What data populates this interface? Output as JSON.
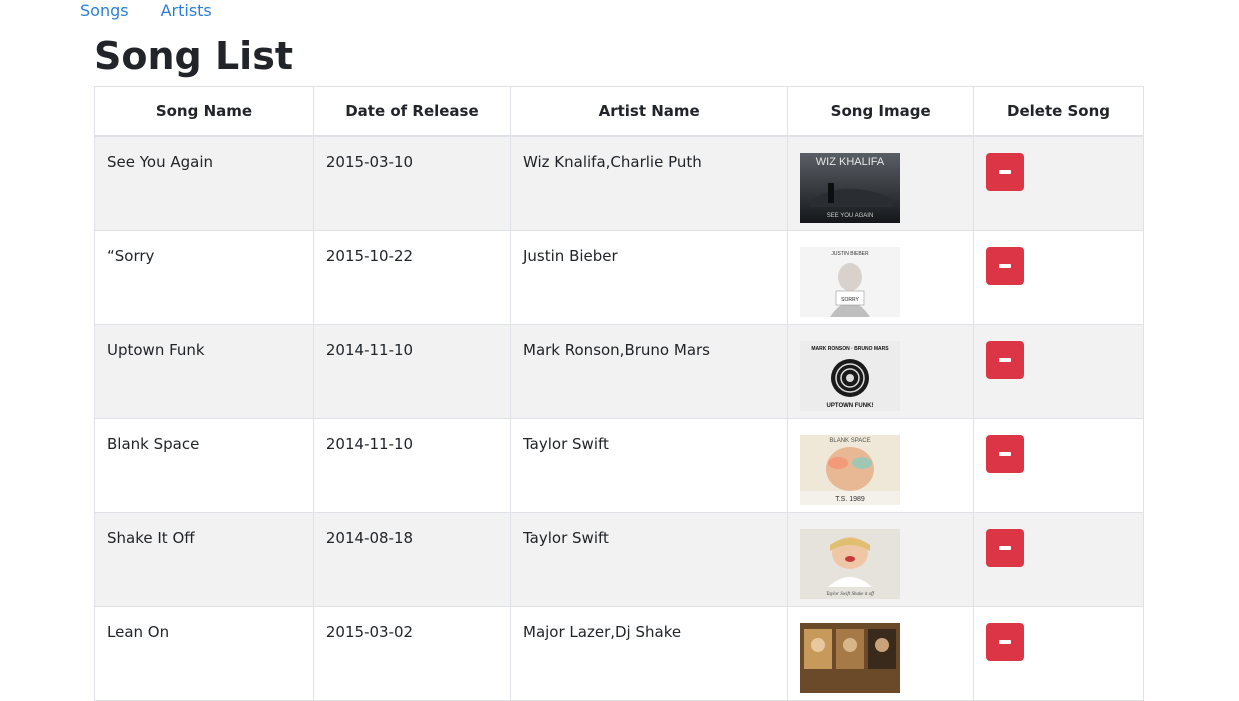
{
  "nav": {
    "songs_label": "Songs",
    "artists_label": "Artists"
  },
  "page": {
    "title": "Song List"
  },
  "table": {
    "headers": [
      "Song Name",
      "Date of Release",
      "Artist Name",
      "Song Image",
      "Delete Song"
    ],
    "rows": [
      {
        "name": "See You Again",
        "date": "2015-03-10",
        "artist": "Wiz Knalifa,Charlie Puth",
        "cover_text_top": "WIZ KHALIFA",
        "cover_text_bottom": "SEE YOU AGAIN"
      },
      {
        "name": "“Sorry",
        "date": "2015-10-22",
        "artist": "Justin Bieber",
        "cover_text_top": "JUSTIN BIEBER",
        "cover_text_bottom": "SORRY"
      },
      {
        "name": "Uptown Funk",
        "date": "2014-11-10",
        "artist": "Mark Ronson,Bruno Mars",
        "cover_text_top": "MARK RONSON · BRUNO MARS",
        "cover_text_bottom": "UPTOWN FUNK!"
      },
      {
        "name": "Blank Space",
        "date": "2014-11-10",
        "artist": "Taylor Swift",
        "cover_text_top": "BLANK SPACE",
        "cover_text_bottom": "T.S. 1989"
      },
      {
        "name": "Shake It Off",
        "date": "2014-08-18",
        "artist": "Taylor Swift",
        "cover_text_top": "",
        "cover_text_bottom": "Taylor Swift  Shake it off"
      },
      {
        "name": "Lean On",
        "date": "2015-03-02",
        "artist": "Major Lazer,Dj Shake",
        "cover_text_top": "",
        "cover_text_bottom": ""
      }
    ]
  },
  "colors": {
    "link": "#2b7fd8",
    "delete_button": "#dc3545",
    "stripe": "#f2f2f2",
    "border": "#dee2e6"
  },
  "icons": {
    "delete": "minus-icon"
  }
}
